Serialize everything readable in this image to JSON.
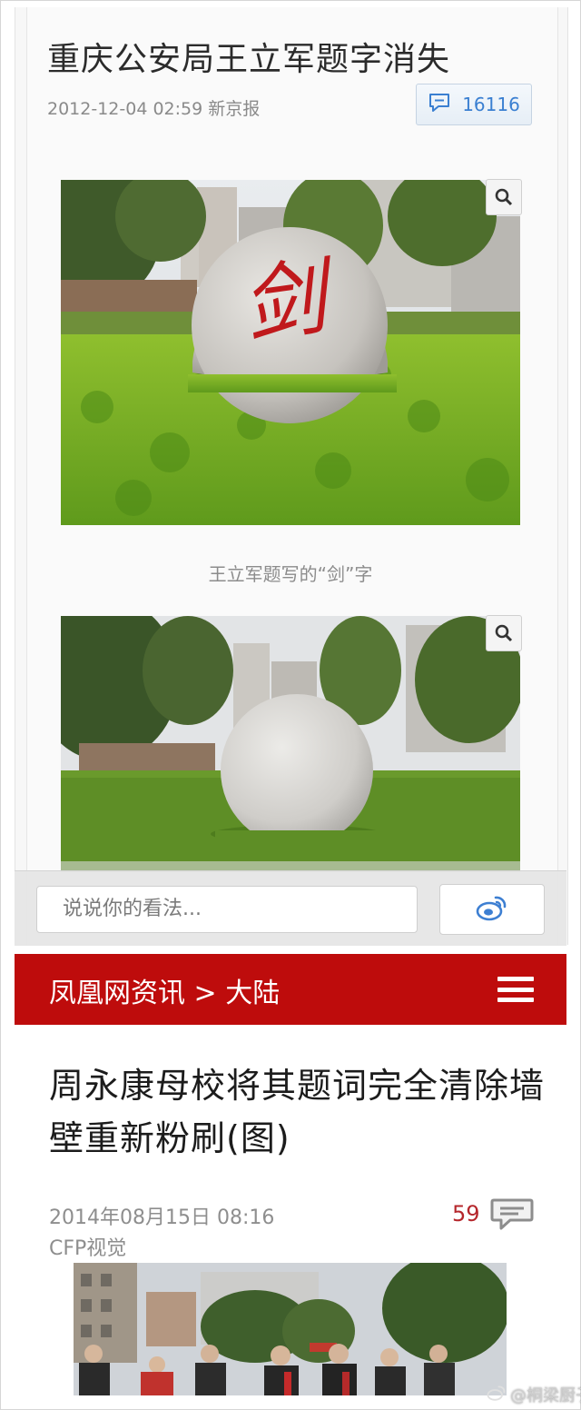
{
  "article1": {
    "title": "重庆公安局王立军题字消失",
    "meta": "2012-12-04 02:59 新京报",
    "comment_count": "16116",
    "caption": "王立军题写的“剑”字",
    "stone_character": "剑",
    "comment_placeholder": "说说你的看法..."
  },
  "article2": {
    "breadcrumb": "凤凰网资讯 > 大陆",
    "title": "周永康母校将其题词完全清除墙壁重新粉刷(图)",
    "date": "2014年08月15日 08:16",
    "source": "CFP视觉",
    "comment_count": "59"
  },
  "watermark": "@桐梁厨子",
  "icons": {
    "comment": "speech-bubble-icon",
    "zoom": "magnifier-icon",
    "weibo": "weibo-logo-icon",
    "menu": "hamburger-menu-icon"
  },
  "colors": {
    "brand_red": "#be0c0c",
    "link_blue": "#3a7fd1",
    "count_red": "#b5262b"
  }
}
